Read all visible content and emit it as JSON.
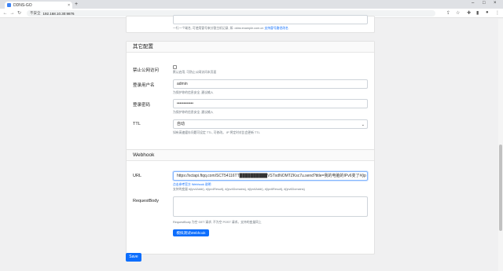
{
  "browser": {
    "tab_title": "DDNS-GO",
    "tab_close": "×",
    "new_tab": "+",
    "security_label": "不安全",
    "url": "192.168.10.30:9876",
    "minimize": "–",
    "maximize": "□",
    "close": "×"
  },
  "top_card": {
    "help_text": "一行一个域名, 可使用冒号来分割主机记录, 如: ddns:example.com.cn",
    "help_link": "支持冒号路径改名"
  },
  "other_config": {
    "title": "其它配置",
    "disable_public": {
      "label": "禁止公网访问",
      "checked": false,
      "help": "默认启用, 可防止公网访问本页面"
    },
    "username": {
      "label": "登录用户名",
      "value": "admin",
      "help": "为保护你的信息安全, 建议输入"
    },
    "password": {
      "label": "登录密码",
      "value": "••••••••••••",
      "help": "为保护你的信息安全, 建议输入"
    },
    "ttl": {
      "label": "TTL",
      "value": "自动",
      "help": "如有高速缓存问题可设定 TTL, 可修改。 IP 将定时对比会更新 TTL"
    }
  },
  "webhook": {
    "title": "Webhook",
    "url": {
      "label": "URL",
      "value": "https://sctapi.ftqq.com/SCT54116TT██████████VSTxdNOMTZKsc7u.send?title=我的电脑的IPv6变了#{ip",
      "help_link": "点击参考官方 Webhook 说明",
      "help": "支持的变量 #{ipv4Addr}, #{ipv4Result}, #{ipv4Domains}, #{ipv6Addr}, #{ipv6Result}, #{ipv6Domains}"
    },
    "request_body": {
      "label": "RequestBody",
      "value": "",
      "help": "RequestBody 为空 GET 请求, 不为空 POST 请求。支持的变量同上"
    },
    "test_button": "模拟测试Webhook"
  },
  "save_button": "Save",
  "colors": {
    "primary": "#0d6efd",
    "page_bg": "#f0f0f1"
  }
}
